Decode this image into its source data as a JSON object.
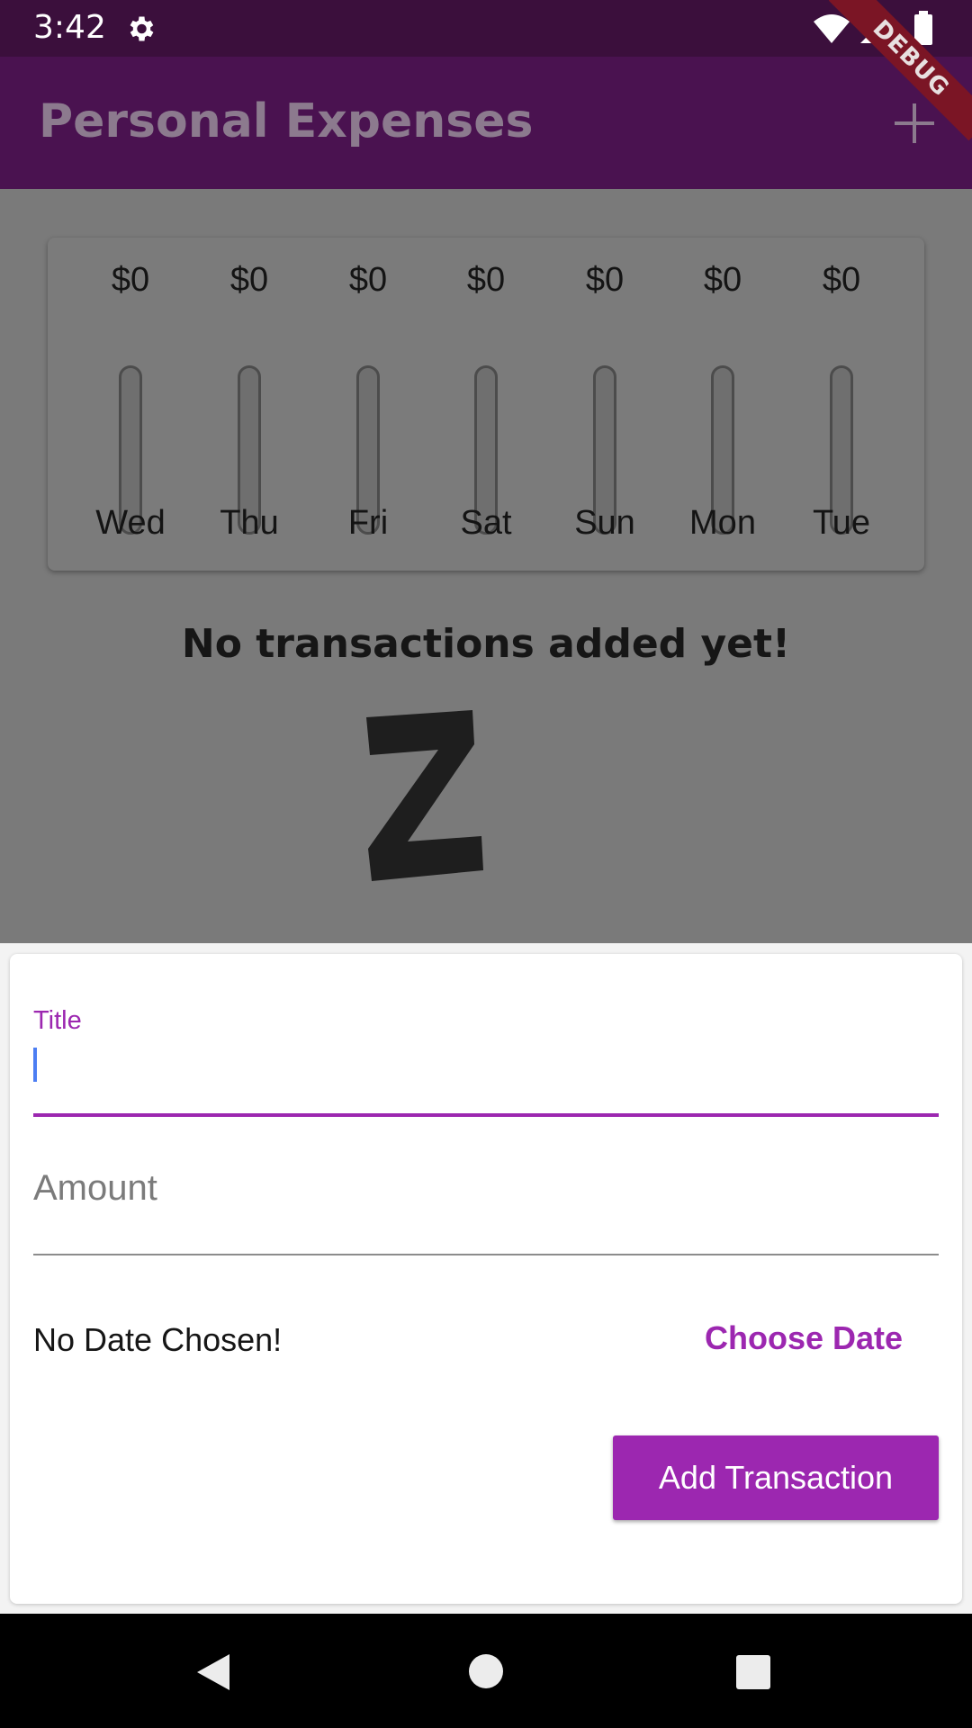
{
  "status_bar": {
    "time": "3:42",
    "icons": [
      "gear-icon",
      "wifi-icon",
      "cellular-icon",
      "battery-icon"
    ]
  },
  "app_bar": {
    "title": "Personal Expenses",
    "action_icon": "add-icon",
    "debug_label": "DEBUG"
  },
  "chart": {
    "columns": [
      {
        "day": "Wed",
        "amount": "$0",
        "fraction": 0
      },
      {
        "day": "Thu",
        "amount": "$0",
        "fraction": 0
      },
      {
        "day": "Fri",
        "amount": "$0",
        "fraction": 0
      },
      {
        "day": "Sat",
        "amount": "$0",
        "fraction": 0
      },
      {
        "day": "Sun",
        "amount": "$0",
        "fraction": 0
      },
      {
        "day": "Mon",
        "amount": "$0",
        "fraction": 0
      },
      {
        "day": "Tue",
        "amount": "$0",
        "fraction": 0
      }
    ]
  },
  "empty_state": {
    "message": "No transactions added yet!",
    "image": "sleeping-z-icon"
  },
  "form": {
    "title_label": "Title",
    "title_value": "",
    "amount_placeholder": "Amount",
    "amount_value": "",
    "date_text": "No Date Chosen!",
    "choose_date_label": "Choose Date",
    "submit_label": "Add Transaction"
  },
  "colors": {
    "primary": "#9c27b0",
    "app_bar": "#4a1250",
    "status_bar": "#3b0f3c",
    "scrim": "#7a7a7a"
  }
}
